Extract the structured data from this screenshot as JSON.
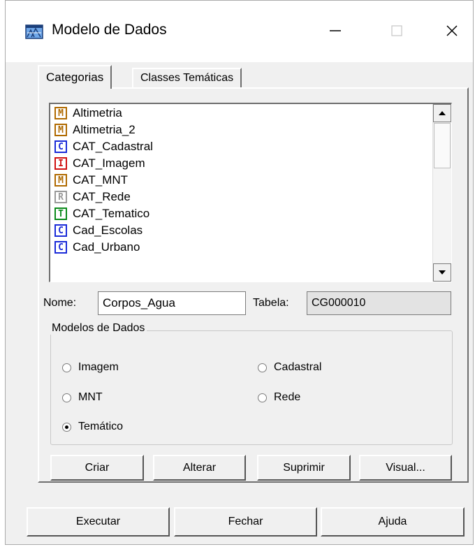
{
  "window": {
    "title": "Modelo de Dados",
    "controls": {
      "minimize": "—",
      "maximize": "□",
      "close": "✕"
    }
  },
  "tabs": [
    {
      "label": "Categorias",
      "active": true
    },
    {
      "label": "Classes Temáticas",
      "active": false
    }
  ],
  "categories": [
    {
      "icon": "M",
      "label": "Altimetria"
    },
    {
      "icon": "M",
      "label": "Altimetria_2"
    },
    {
      "icon": "C",
      "label": "CAT_Cadastral"
    },
    {
      "icon": "I",
      "label": "CAT_Imagem"
    },
    {
      "icon": "M",
      "label": "CAT_MNT"
    },
    {
      "icon": "R",
      "label": "CAT_Rede"
    },
    {
      "icon": "T",
      "label": "CAT_Tematico"
    },
    {
      "icon": "C",
      "label": "Cad_Escolas"
    },
    {
      "icon": "C",
      "label": "Cad_Urbano"
    }
  ],
  "form": {
    "nome_label": "Nome:",
    "nome_value": "Corpos_Agua",
    "tabela_label": "Tabela:",
    "tabela_value": "CG000010"
  },
  "model_group": {
    "legend": "Modelos de Dados",
    "options": [
      {
        "label": "Imagem",
        "selected": false
      },
      {
        "label": "Cadastral",
        "selected": false
      },
      {
        "label": "MNT",
        "selected": false
      },
      {
        "label": "Rede",
        "selected": false
      },
      {
        "label": "Temático",
        "selected": true
      }
    ]
  },
  "panel_buttons": [
    "Criar",
    "Alterar",
    "Suprimir",
    "Visual..."
  ],
  "dialog_buttons": [
    "Executar",
    "Fechar",
    "Ajuda"
  ],
  "colors": {
    "icon_M": "#b06a00",
    "icon_C": "#1a2bd8",
    "icon_I": "#d01010",
    "icon_R": "#9a9a9a",
    "icon_T": "#0a8a1a",
    "dialog_bg": "#f0f0f0"
  }
}
